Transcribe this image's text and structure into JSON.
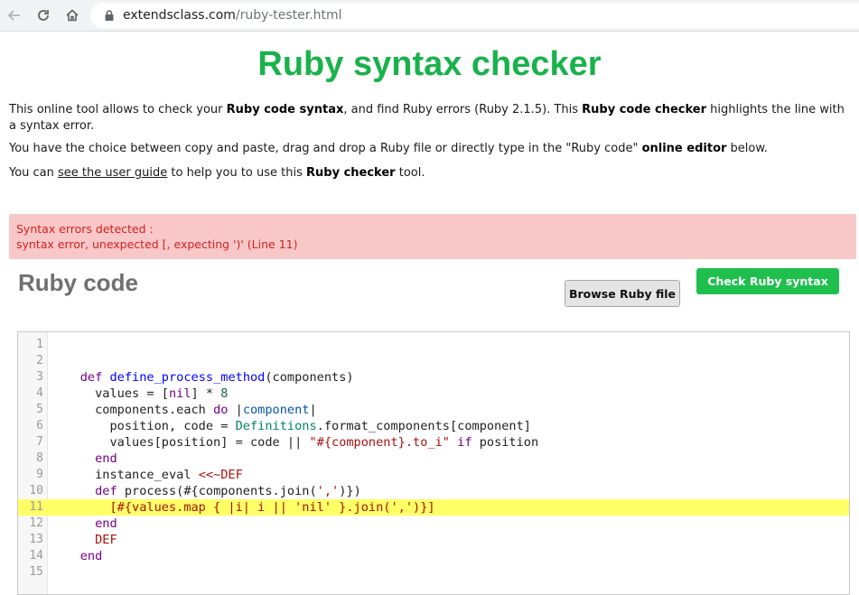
{
  "browser": {
    "url_host": "extendsclass.com",
    "url_path": "/ruby-tester.html"
  },
  "page": {
    "title": "Ruby syntax checker",
    "intro1": {
      "t1": "This online tool allows to check your ",
      "b1": "Ruby code syntax",
      "t2": ", and find Ruby errors (Ruby 2.1.5). This ",
      "b2": "Ruby code checker",
      "t3": " highlights the line with a syntax error."
    },
    "intro2": {
      "t1": "You have the choice between copy and paste, drag and drop a Ruby file or directly type in the \"Ruby code\" ",
      "b1": "online editor",
      "t2": " below."
    },
    "intro3": {
      "t1": "You can ",
      "link": "see the user guide",
      "t2": " to help you to use this ",
      "b1": "Ruby checker",
      "t3": " tool."
    },
    "error": {
      "line1": "Syntax errors detected :",
      "line2": "syntax error, unexpected [, expecting ')' (Line 11)"
    },
    "section_title": "Ruby code",
    "browse_button": "Browse Ruby file",
    "check_button": "Check Ruby syntax"
  },
  "editor": {
    "highlight_line": 11,
    "line_numbers": [
      "1",
      "2",
      "3",
      "4",
      "5",
      "6",
      "7",
      "8",
      "9",
      "10",
      "11",
      "12",
      "13",
      "14",
      "15"
    ],
    "lines": [
      "",
      "",
      "    def define_process_method(components)",
      "      values = [nil] * 8",
      "      components.each do |component|",
      "        position, code = Definitions.format_components[component]",
      "        values[position] = code || \"#{component}.to_i\" if position",
      "      end",
      "      instance_eval <<~DEF",
      "      def process(#{components.join(',')})",
      "        [#{values.map { |i| i || 'nil' }.join(',')}]",
      "      end",
      "      DEF",
      "    end",
      ""
    ]
  },
  "colors": {
    "title_green": "#1ab24b",
    "error_bg": "#f8c8c8",
    "error_text": "#d61f1f",
    "check_button_bg": "#1fbf4d",
    "highlight": "#ffff66"
  }
}
